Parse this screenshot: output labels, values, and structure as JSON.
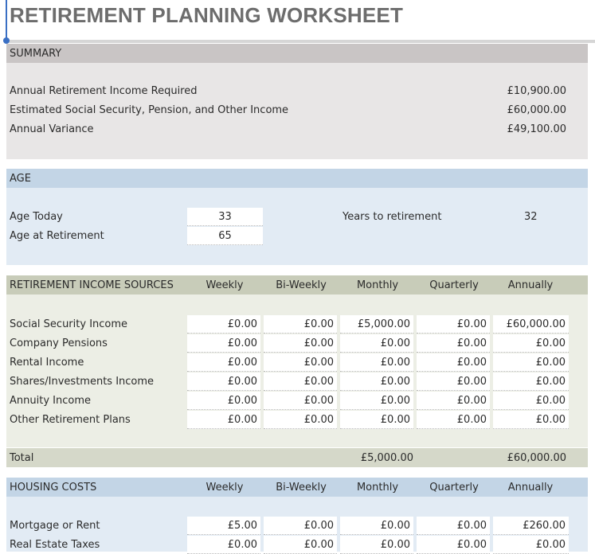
{
  "title": "RETIREMENT PLANNING WORKSHEET",
  "summary": {
    "header": "SUMMARY",
    "rows": [
      {
        "label": "Annual Retirement Income Required",
        "value": "£10,900.00"
      },
      {
        "label": "Estimated Social Security, Pension, and Other Income",
        "value": "£60,000.00"
      },
      {
        "label": "Annual Variance",
        "value": "£49,100.00"
      }
    ]
  },
  "age": {
    "header": "AGE",
    "age_today_label": "Age Today",
    "age_today": "33",
    "age_retirement_label": "Age at Retirement",
    "age_retirement": "65",
    "years_label": "Years to retirement",
    "years": "32"
  },
  "income": {
    "header": "RETIREMENT INCOME SOURCES",
    "columns": [
      "Weekly",
      "Bi-Weekly",
      "Monthly",
      "Quarterly",
      "Annually"
    ],
    "rows": [
      {
        "label": "Social Security Income",
        "values": [
          "£0.00",
          "£0.00",
          "£5,000.00",
          "£0.00",
          "£60,000.00"
        ]
      },
      {
        "label": "Company Pensions",
        "values": [
          "£0.00",
          "£0.00",
          "£0.00",
          "£0.00",
          "£0.00"
        ]
      },
      {
        "label": "Rental Income",
        "values": [
          "£0.00",
          "£0.00",
          "£0.00",
          "£0.00",
          "£0.00"
        ]
      },
      {
        "label": "Shares/Investments Income",
        "values": [
          "£0.00",
          "£0.00",
          "£0.00",
          "£0.00",
          "£0.00"
        ]
      },
      {
        "label": "Annuity Income",
        "values": [
          "£0.00",
          "£0.00",
          "£0.00",
          "£0.00",
          "£0.00"
        ]
      },
      {
        "label": "Other Retirement Plans",
        "values": [
          "£0.00",
          "£0.00",
          "£0.00",
          "£0.00",
          "£0.00"
        ]
      }
    ],
    "total_label": "Total",
    "total_monthly": "£5,000.00",
    "total_annually": "£60,000.00"
  },
  "housing": {
    "header": "HOUSING COSTS",
    "columns": [
      "Weekly",
      "Bi-Weekly",
      "Monthly",
      "Quarterly",
      "Annually"
    ],
    "rows": [
      {
        "label": "Mortgage or Rent",
        "values": [
          "£5.00",
          "£0.00",
          "£0.00",
          "£0.00",
          "£260.00"
        ]
      },
      {
        "label": "Real Estate Taxes",
        "values": [
          "£0.00",
          "£0.00",
          "£0.00",
          "£0.00",
          "£0.00"
        ]
      }
    ]
  }
}
